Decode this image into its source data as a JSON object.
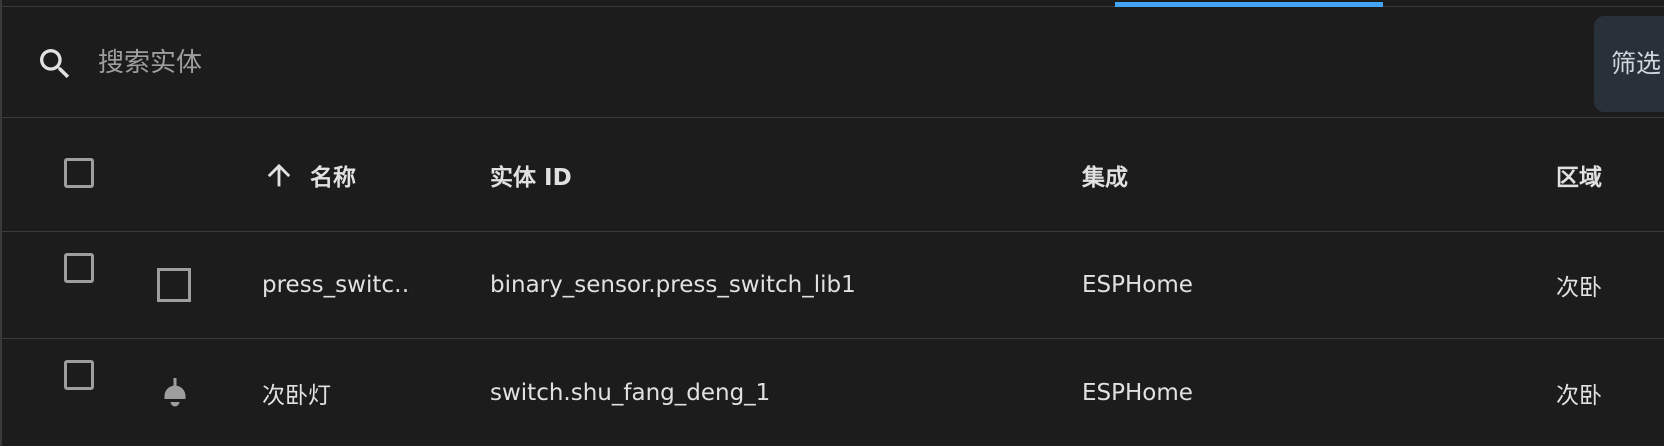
{
  "search": {
    "placeholder": "搜索实体"
  },
  "filter": {
    "label": "筛选"
  },
  "table": {
    "headers": {
      "name": "名称",
      "entity_id": "实体 ID",
      "integration": "集成",
      "area": "区域"
    },
    "sort": {
      "column": "name",
      "direction": "ascending"
    },
    "rows": [
      {
        "icon": "checkbox-blank-outline-icon",
        "name": "press_switc…",
        "entity_id": "binary_sensor.press_switch_lib1",
        "integration": "ESPHome",
        "area": "次卧"
      },
      {
        "icon": "ceiling-light-icon",
        "name": "次卧灯",
        "entity_id": "switch.shu_fang_deng_1",
        "integration": "ESPHome",
        "area": "次卧"
      }
    ]
  },
  "colors": {
    "background": "#1c1c1c",
    "divider": "#3a3a3a",
    "accent": "#42a5f5",
    "filter_button_bg": "#283039",
    "icon_gray": "#9e9e9e"
  }
}
